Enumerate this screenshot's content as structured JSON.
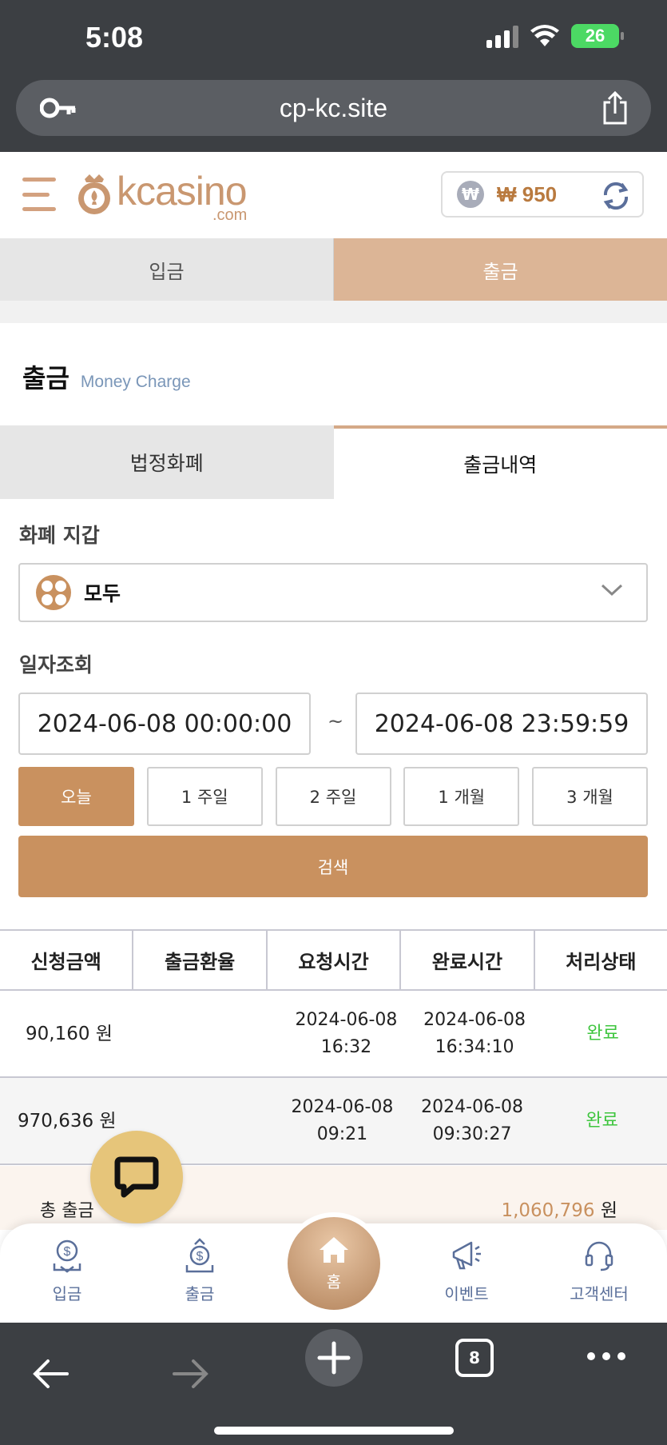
{
  "status_bar": {
    "time": "5:08",
    "battery": "26"
  },
  "browser": {
    "url": "cp-kc.site",
    "tabs_count": "8"
  },
  "header": {
    "logo_text": "kcasino",
    "logo_sub": ".com",
    "currency_symbol": "₩",
    "balance": "₩ 950"
  },
  "main_tabs": [
    {
      "label": "입금",
      "active": false
    },
    {
      "label": "출금",
      "active": true
    }
  ],
  "section": {
    "title": "출금",
    "subtitle": "Money Charge"
  },
  "sub_tabs": [
    {
      "label": "법정화폐",
      "active": false
    },
    {
      "label": "출금내역",
      "active": true
    }
  ],
  "filters": {
    "currency_label": "화폐 지갑",
    "currency_value": "모두",
    "date_label": "일자조회",
    "date_from": "2024-06-08 00:00:00",
    "date_to": "2024-06-08 23:59:59",
    "separator": "~",
    "ranges": [
      "오늘",
      "1 주일",
      "2 주일",
      "1 개월",
      "3 개월"
    ],
    "active_range": "오늘",
    "search_label": "검색"
  },
  "table": {
    "headers": [
      "신청금액",
      "출금환율",
      "요청시간",
      "완료시간",
      "처리상태"
    ],
    "rows": [
      {
        "amount": "90,160 원",
        "rate": "",
        "req_date": "2024-06-08",
        "req_time": "16:32",
        "done_date": "2024-06-08",
        "done_time": "16:34:10",
        "status": "완료"
      },
      {
        "amount": "970,636 원",
        "rate": "",
        "req_date": "2024-06-08",
        "req_time": "09:21",
        "done_date": "2024-06-08",
        "done_time": "09:30:27",
        "status": "완료"
      }
    ]
  },
  "total": {
    "label": "총 출금",
    "value": "1,060,796",
    "unit": "원"
  },
  "bottom_nav": {
    "deposit": "입금",
    "withdraw": "출금",
    "home": "홈",
    "event": "이벤트",
    "support": "고객센터"
  },
  "colors": {
    "accent": "#c9915f",
    "tab_active": "#dcb596",
    "status_done": "#3ec53e"
  }
}
